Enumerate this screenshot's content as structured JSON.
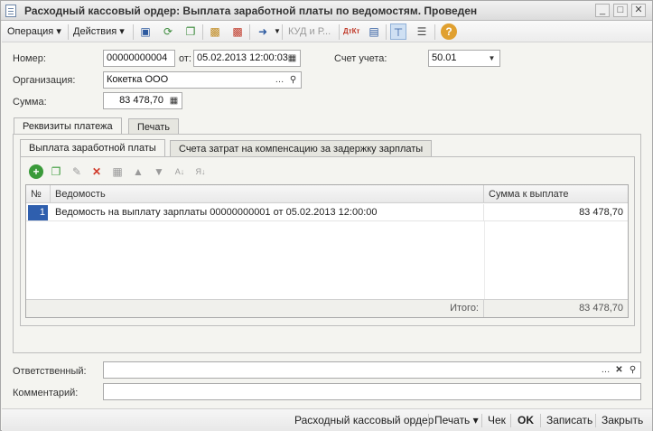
{
  "window": {
    "title": "Расходный кассовый ордер: Выплата заработной платы по ведомостям. Проведен",
    "btn_minimize": "_",
    "btn_maximize": "□",
    "btn_close": "✕"
  },
  "toolbar": {
    "operation": "Операция ▾",
    "actions": "Действия ▾",
    "kudir": "КУД и Р...",
    "dt_kt": "ДтКт",
    "help": "?"
  },
  "form": {
    "number_label": "Номер:",
    "number_value": "00000000004",
    "date_label": "от:",
    "date_value": "05.02.2013 12:00:03",
    "account_label": "Счет учета:",
    "account_value": "50.01",
    "org_label": "Организация:",
    "org_value": "Кокетка ООО",
    "sum_label": "Сумма:",
    "sum_value": "83 478,70",
    "responsible_label": "Ответственный:",
    "responsible_value": "",
    "comment_label": "Комментарий:",
    "comment_value": ""
  },
  "tabs": {
    "outer": [
      "Реквизиты платежа",
      "Печать"
    ],
    "inner": [
      "Выплата заработной платы",
      "Счета затрат на компенсацию за задержку зарплаты"
    ]
  },
  "table": {
    "headers": [
      "№",
      "Ведомость",
      "Сумма к выплате"
    ],
    "rows": [
      {
        "num": "1",
        "statement": "Ведомость на выплату зарплаты 00000000001 от 05.02.2013 12:00:00",
        "amount": "83 478,70"
      }
    ],
    "total_label": "Итого:",
    "total_value": "83 478,70"
  },
  "commands": {
    "doc": "Расходный кассовый ордер",
    "print": "Печать ▾",
    "receipt": "Чек",
    "ok": "OK",
    "save": "Записать",
    "close": "Закрыть"
  },
  "colors": {
    "accent_green": "#3a9a3a",
    "accent_red": "#d03a2a",
    "selection_blue": "#2f5fae"
  }
}
